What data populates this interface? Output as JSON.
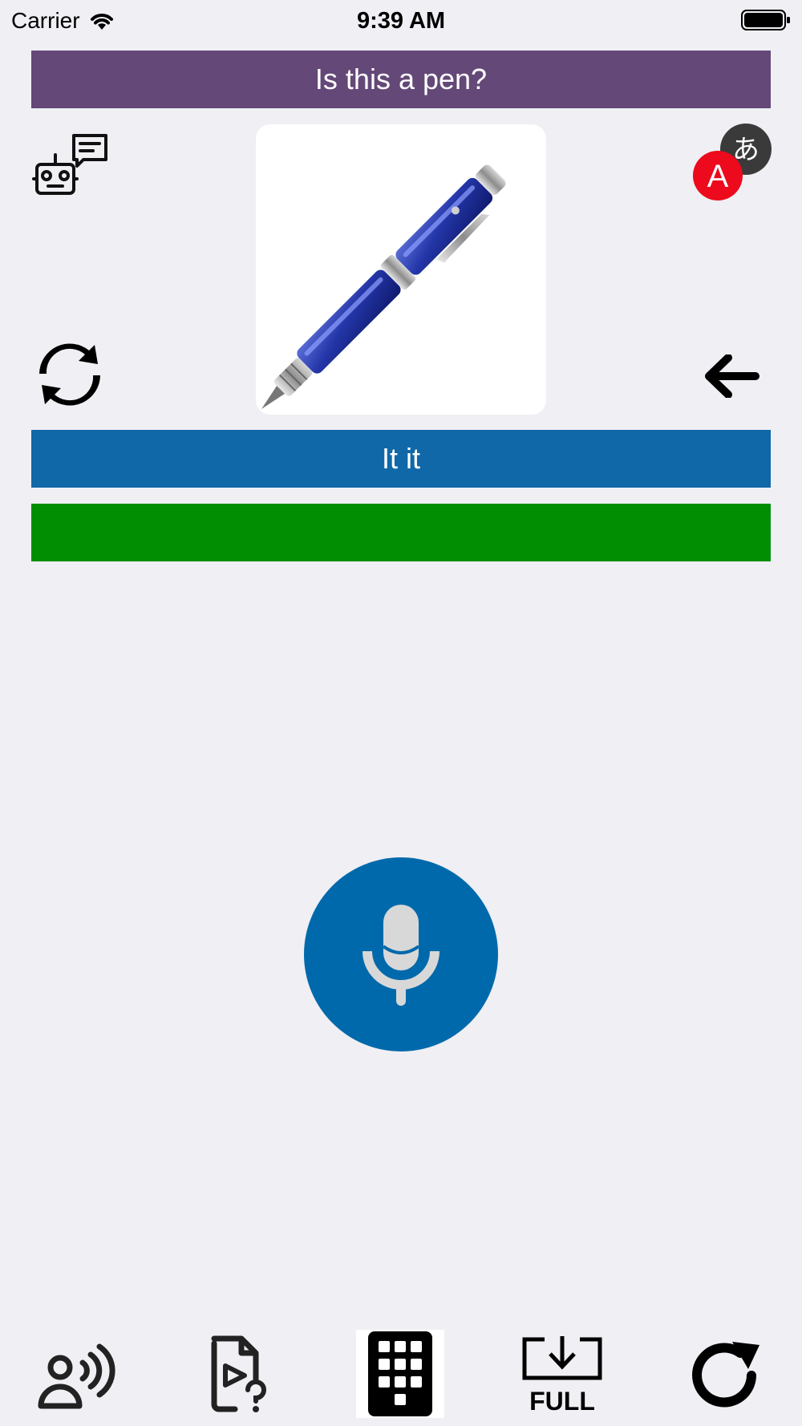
{
  "status_bar": {
    "carrier": "Carrier",
    "time": "9:39 AM",
    "icons": [
      "wifi-icon",
      "battery-icon"
    ]
  },
  "question": {
    "text": "Is this a pen?",
    "color": "#644878"
  },
  "image": {
    "subject": "blue ballpoint pen",
    "icon": "pen-image"
  },
  "left_controls": {
    "top_icon": "robot-chat-icon",
    "bottom_icon": "refresh-arrows-icon"
  },
  "right_controls": {
    "top_icon": "translate-icon",
    "translate_latin": "A",
    "translate_kana": "あ",
    "bottom_icon": "arrow-left-icon"
  },
  "answer": {
    "text": "It it",
    "color": "#1068a8"
  },
  "feedback": {
    "text": "",
    "color": "#018e02"
  },
  "microphone": {
    "icon": "microphone-icon",
    "color": "#0069ab"
  },
  "bottom_toolbar": {
    "items": [
      {
        "icon": "speaker-voice-icon"
      },
      {
        "icon": "video-help-icon"
      },
      {
        "icon": "keypad-icon"
      },
      {
        "icon": "full-download-icon",
        "label": "FULL"
      },
      {
        "icon": "reload-icon"
      }
    ]
  }
}
